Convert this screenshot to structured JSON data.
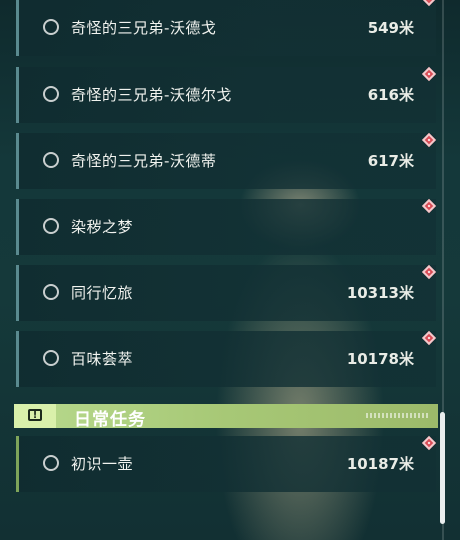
{
  "quests": [
    {
      "name": "奇怪的三兄弟-沃德戈",
      "distance": "549米",
      "marker": true
    },
    {
      "name": "奇怪的三兄弟-沃德尔戈",
      "distance": "616米",
      "marker": true
    },
    {
      "name": "奇怪的三兄弟-沃德蒂",
      "distance": "617米",
      "marker": true
    },
    {
      "name": "染秽之梦",
      "distance": "",
      "marker": true
    },
    {
      "name": "同行忆旅",
      "distance": "10313米",
      "marker": true
    },
    {
      "name": "百味荟萃",
      "distance": "10178米",
      "marker": true
    }
  ],
  "daily_section": {
    "icon": "exclamation-box-icon",
    "icon_glyph": "!",
    "title": "日常任务"
  },
  "daily_quests": [
    {
      "name": "初识一壶",
      "distance": "10187米",
      "marker": true
    }
  ],
  "colors": {
    "marker": "#d84b55",
    "section_header": "#b7d98d",
    "quest_border": "#5a8a8f"
  }
}
